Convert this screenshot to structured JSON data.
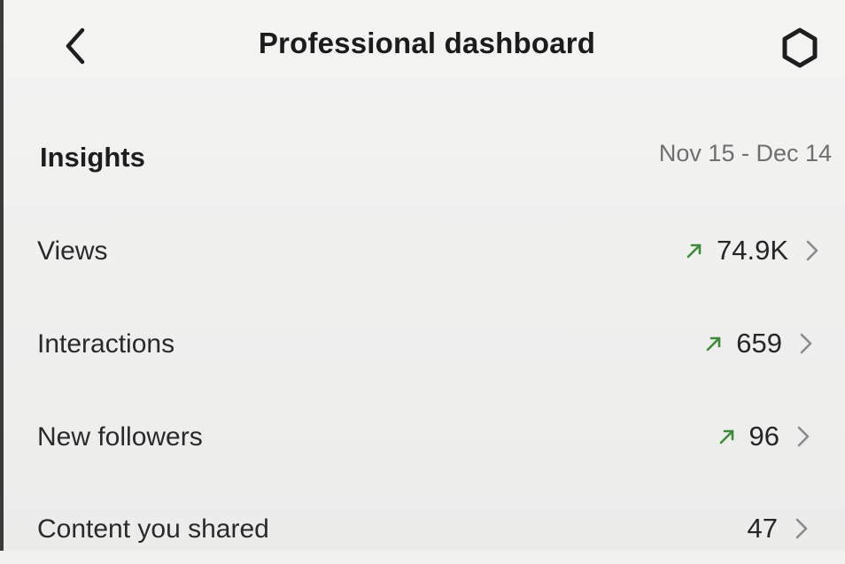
{
  "header": {
    "title": "Professional dashboard",
    "back_icon": "chevron-left-icon",
    "settings_icon": "gear-icon"
  },
  "insights": {
    "title": "Insights",
    "date_range": "Nov 15 - Dec 14",
    "rows": [
      {
        "label": "Views",
        "value": "74.9K",
        "trend": "up"
      },
      {
        "label": "Interactions",
        "value": "659",
        "trend": "up"
      },
      {
        "label": "New followers",
        "value": "96",
        "trend": "up"
      },
      {
        "label": "Content you shared",
        "value": "47",
        "trend": ""
      }
    ]
  },
  "colors": {
    "trend_up": "#3f8a3a",
    "chevron": "#8a8a8a",
    "background": "#f1f1f0"
  }
}
